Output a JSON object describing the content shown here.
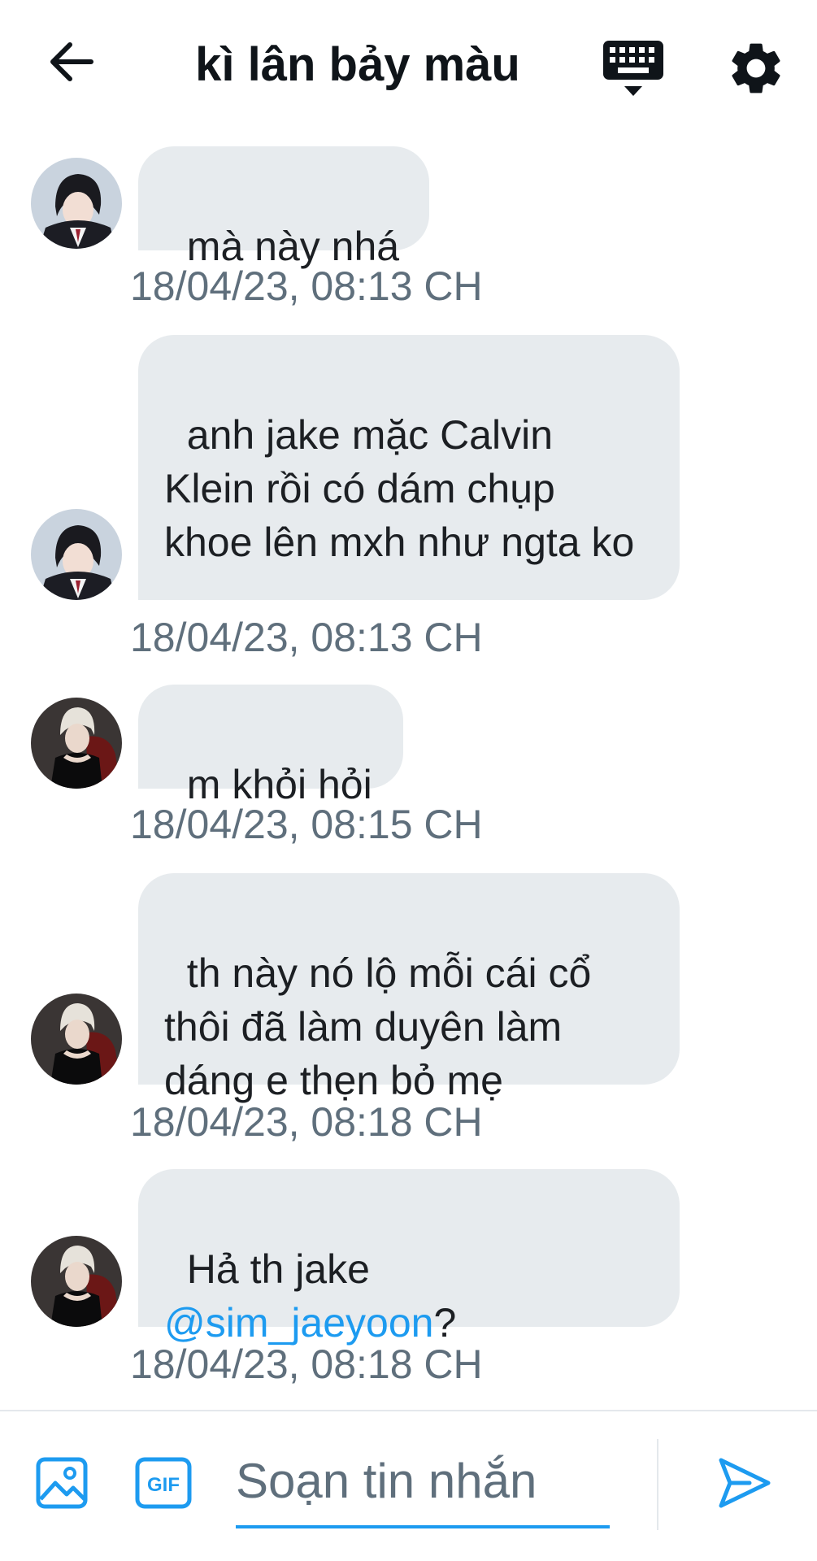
{
  "header": {
    "title": "kì lân bảy màu",
    "back_icon": "arrow-left-icon",
    "keyboard_icon": "keyboard-icon",
    "settings_icon": "gear-icon"
  },
  "messages": [
    {
      "text": "mà này nhá",
      "time": "18/04/23, 08:13 CH",
      "avatar": "avatar-user-a"
    },
    {
      "text": "anh jake mặc Calvin Klein rồi có dám chụp khoe lên mxh như ngta ko",
      "time": "18/04/23, 08:13 CH",
      "avatar": "avatar-user-a"
    },
    {
      "text": "m khỏi hỏi",
      "time": "18/04/23, 08:15 CH",
      "avatar": "avatar-user-b"
    },
    {
      "text": "th này nó lộ mỗi cái cổ thôi đã làm duyên làm dáng e thẹn bỏ mẹ",
      "time": "18/04/23, 08:18 CH",
      "avatar": "avatar-user-b"
    },
    {
      "text_before": "Hả th jake",
      "mention": "@sim_jaeyoon",
      "text_after": "?",
      "time": "18/04/23, 08:18 CH",
      "avatar": "avatar-user-b"
    }
  ],
  "composer": {
    "placeholder": "Soạn tin nhắn",
    "value": "",
    "gif_label": "GIF",
    "image_icon": "image-icon",
    "send_icon": "send-icon"
  },
  "colors": {
    "accent": "#1d9bf0",
    "bubble": "#e7ebee",
    "timestamp": "#5f6f7c"
  }
}
